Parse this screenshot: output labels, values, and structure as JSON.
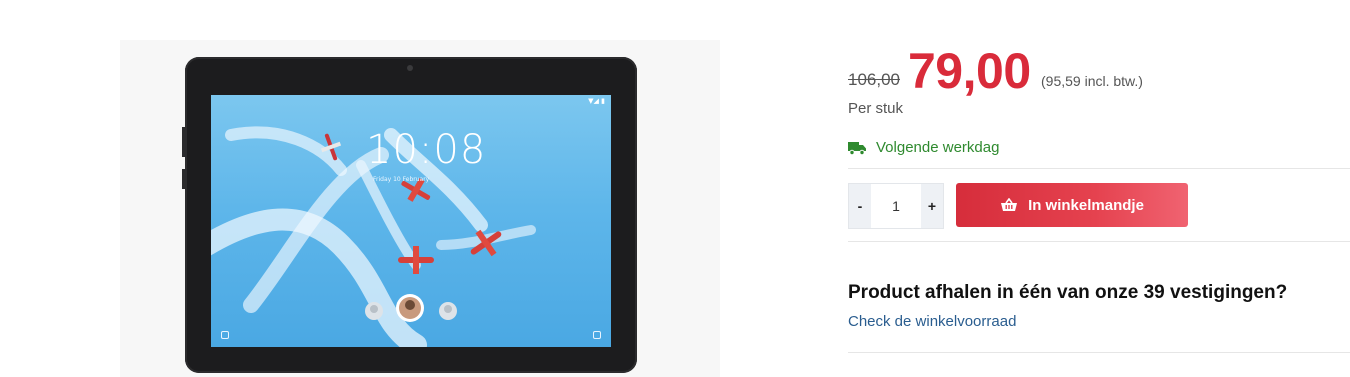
{
  "product": {
    "image_alt": "Tablet product image",
    "screen": {
      "time": "10:08",
      "date": "Friday 10 February",
      "status": "▼◢ ▮"
    }
  },
  "pricing": {
    "old_price": "106,00",
    "new_price": "79,00",
    "incl_vat": "(95,59 incl. btw.)",
    "unit": "Per stuk"
  },
  "delivery": {
    "icon": "truck-icon",
    "label": "Volgende werkdag",
    "color": "#2f8a2f"
  },
  "cart": {
    "decrement_label": "-",
    "quantity": "1",
    "increment_label": "+",
    "button_icon": "basket-icon",
    "button_label": "In winkelmandje",
    "button_color": "#d92b3a"
  },
  "pickup": {
    "title": "Product afhalen in één van onze 39 vestigingen?",
    "link_label": "Check de winkelvoorraad"
  }
}
